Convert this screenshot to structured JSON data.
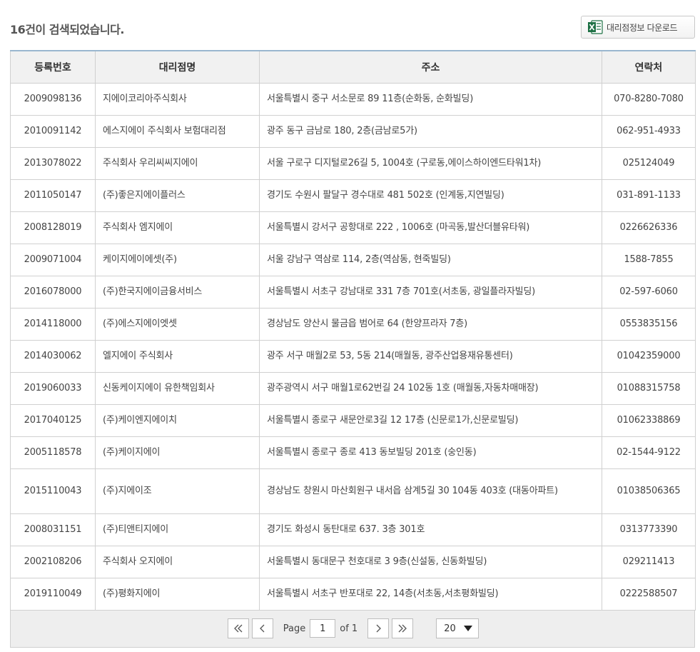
{
  "header": {
    "result_text": "16건이 검색되었습니다.",
    "download_label": "대리점정보 다운로드",
    "excel_icon": "excel-file-icon",
    "excel_color": "#1e7145"
  },
  "table": {
    "columns": [
      "등록번호",
      "대리점명",
      "주소",
      "연락처"
    ],
    "rows": [
      {
        "reg": "2009098136",
        "name": "지에이코리아주식회사",
        "addr": "서울특별시 중구 서소문로 89 11층(순화동, 순화빌딩)",
        "phone": "070-8280-7080"
      },
      {
        "reg": "2010091142",
        "name": "에스지에이 주식회사 보험대리점",
        "addr": "광주 동구 금남로 180, 2층(금남로5가)",
        "phone": "062-951-4933"
      },
      {
        "reg": "2013078022",
        "name": "주식회사 우리씨씨지에이",
        "addr": "서울 구로구 디지털로26길 5, 1004호 (구로동,에이스하이엔드타워1차)",
        "phone": "025124049"
      },
      {
        "reg": "2011050147",
        "name": "(주)좋은지에이플러스",
        "addr": "경기도 수원시 팔달구 경수대로 481 502호 (인계동,지연빌딩)",
        "phone": "031-891-1133"
      },
      {
        "reg": "2008128019",
        "name": "주식회사 엠지에이",
        "addr": "서울특별시 강서구 공항대로 222 , 1006호 (마곡동,발산더블유타워)",
        "phone": "0226626336"
      },
      {
        "reg": "2009071004",
        "name": "케이지에이에셋(주)",
        "addr": "서울 강남구 역삼로 114, 2층(역삼동, 현죽빌딩)",
        "phone": "1588-7855"
      },
      {
        "reg": "2016078000",
        "name": "(주)한국지에이금융서비스",
        "addr": "서울특별시 서초구 강남대로 331 7층 701호(서초동, 광일플라자빌딩)",
        "phone": "02-597-6060"
      },
      {
        "reg": "2014118000",
        "name": "(주)에스지에이엣셋",
        "addr": "경상남도 양산시 물금읍 범어로 64 (한양프라자 7층)",
        "phone": "0553835156"
      },
      {
        "reg": "2014030062",
        "name": "엘지에이 주식회사",
        "addr": "광주 서구 매월2로 53, 5동 214(매월동, 광주산업용재유통센터)",
        "phone": "01042359000"
      },
      {
        "reg": "2019060033",
        "name": "신동케이지에이 유한책임회사",
        "addr": "광주광역시 서구 매월1로62번길 24 102동 1호 (매월동,자동차매매장)",
        "phone": "01088315758"
      },
      {
        "reg": "2017040125",
        "name": "(주)케이엔지에이치",
        "addr": "서울특별시 종로구 새문안로3길 12 17층 (신문로1가,신문로빌딩)",
        "phone": "01062338869"
      },
      {
        "reg": "2005118578",
        "name": "(주)케이지에이",
        "addr": "서울특별시 종로구 종로 413 동보빌딩 201호 (숭인동)",
        "phone": "02-1544-9122"
      },
      {
        "reg": "2015110043",
        "name": "(주)지에이조",
        "addr": "경상남도 창원시 마산회원구 내서읍 삼계5길 30 104동 403호 (대동아파트)",
        "phone": "01038506365"
      },
      {
        "reg": "2008031151",
        "name": "(주)티앤티지에이",
        "addr": "경기도 화성시 동탄대로 637. 3층 301호",
        "phone": "0313773390"
      },
      {
        "reg": "2002108206",
        "name": "주식회사 오지에이",
        "addr": "서울특별시 동대문구 천호대로 3 9층(신설동, 신동화빌딩)",
        "phone": "029211413"
      },
      {
        "reg": "2019110049",
        "name": "(주)평화지에이",
        "addr": "서울특별시 서초구 반포대로 22, 14층(서초동,서초평화빌딩)",
        "phone": "0222588507"
      }
    ]
  },
  "pager": {
    "page_label": "Page",
    "page_value": "1",
    "of_label": "of 1",
    "page_size": "20",
    "icons": [
      "first-page-icon",
      "prev-page-icon",
      "next-page-icon",
      "last-page-icon",
      "dropdown-caret-icon"
    ]
  }
}
